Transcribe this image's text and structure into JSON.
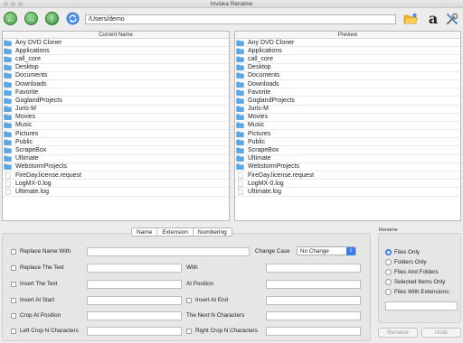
{
  "window": {
    "title": "Inviska Rename"
  },
  "toolbar": {
    "path": "/Users/demo"
  },
  "panes": {
    "left_header": "Current Name",
    "right_header": "Preview",
    "files": [
      {
        "name": "Any DVD Cloner",
        "kind": "folder"
      },
      {
        "name": "Applications",
        "kind": "folder"
      },
      {
        "name": "call_core",
        "kind": "folder"
      },
      {
        "name": "Desktop",
        "kind": "folder"
      },
      {
        "name": "Documents",
        "kind": "folder"
      },
      {
        "name": "Downloads",
        "kind": "folder"
      },
      {
        "name": "Favorite",
        "kind": "folder"
      },
      {
        "name": "GoglandProjects",
        "kind": "folder"
      },
      {
        "name": "Juris-M",
        "kind": "folder"
      },
      {
        "name": "Movies",
        "kind": "folder"
      },
      {
        "name": "Music",
        "kind": "folder"
      },
      {
        "name": "Pictures",
        "kind": "folder"
      },
      {
        "name": "Public",
        "kind": "folder"
      },
      {
        "name": "ScrapeBox",
        "kind": "folder"
      },
      {
        "name": "Ultimate",
        "kind": "folder"
      },
      {
        "name": "WebstormProjects",
        "kind": "folder"
      },
      {
        "name": "FireDay.license.request",
        "kind": "file"
      },
      {
        "name": "LogMX-0.log",
        "kind": "file"
      },
      {
        "name": "Ultimate.log",
        "kind": "file"
      }
    ]
  },
  "tabs": [
    "Name",
    "Extension",
    "Numbering"
  ],
  "options": {
    "replace_name_with": "Replace Name With",
    "change_case": "Change Case",
    "change_case_value": "No Change",
    "replace_the_text": "Replace The Text",
    "with": "With",
    "insert_the_text": "Insert The Text",
    "at_position": "At Position",
    "insert_at_start": "Insert At Start",
    "insert_at_end": "Insert At End",
    "crop_at_position": "Crop At Position",
    "the_next_n_characters": "The Next N Characters",
    "left_crop": "Left Crop N Characters",
    "right_crop": "Right Crop N Characters"
  },
  "rename_panel": {
    "title": "Rename",
    "options": [
      "Files Only",
      "Folders Only",
      "Files And Folders",
      "Selected Items Only",
      "Files With Extensions:"
    ],
    "selected_index": 0
  },
  "buttons": {
    "rename": "Rename",
    "undo": "Undo"
  },
  "colors": {
    "accent": "#3b7ee8",
    "folder": "#5aa7e6",
    "go_green": "#3e9b3e"
  }
}
